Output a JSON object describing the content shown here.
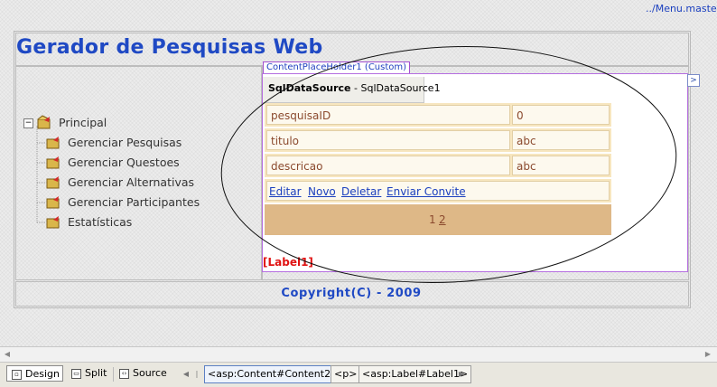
{
  "master_path": "../Menu.master",
  "site_title": "Gerador de Pesquisas Web",
  "tree": {
    "root": "Principal",
    "children": [
      "Gerenciar Pesquisas",
      "Gerenciar Questoes",
      "Gerenciar Alternativas",
      "Gerenciar Participantes",
      "Estatísticas"
    ]
  },
  "content_placeholder_tag": "ContentPlaceHolder1 (Custom)",
  "sqldatasource": {
    "type": "SqlDataSource",
    "id": "SqlDataSource1"
  },
  "detailsview": {
    "rows": [
      {
        "field": "pesquisaID",
        "value": "0"
      },
      {
        "field": "titulo",
        "value": "abc"
      },
      {
        "field": "descricao",
        "value": "abc"
      }
    ],
    "commands": [
      "Editar",
      "Novo",
      "Deletar",
      "Enviar Convite"
    ],
    "pager": {
      "current": "1",
      "next": "2"
    }
  },
  "label1": "[Label1]",
  "copyright": "Copyright(C) - 2009",
  "view_buttons": [
    "Design",
    "Split",
    "Source"
  ],
  "active_view": "Design",
  "tag_breadcrumb": [
    "<asp:Content#Content2>",
    "<p>",
    "<asp:Label#Label1>"
  ],
  "colors": {
    "title_blue": "#1f49c4",
    "details_header": "#deb887",
    "details_text": "#8b4a2e",
    "label_red": "#e01313",
    "placeholder_border": "#b56ee0"
  }
}
